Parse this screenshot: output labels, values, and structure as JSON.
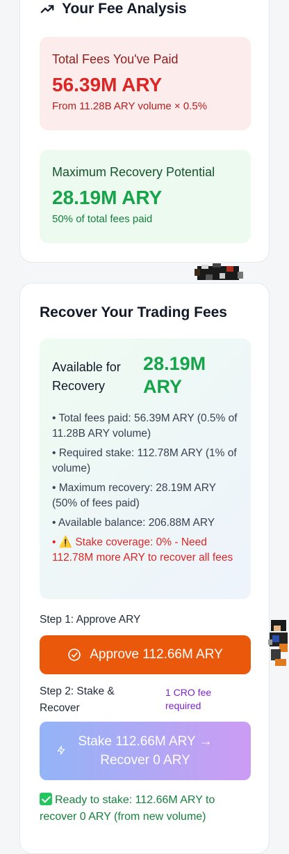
{
  "fee_analysis": {
    "title": "Your Fee Analysis",
    "total_fees": {
      "label": "Total Fees You've Paid",
      "value": "56.39M ARY",
      "detail": "From 11.28B ARY volume × 0.5%"
    },
    "max_recovery": {
      "label": "Maximum Recovery Potential",
      "value": "28.19M ARY",
      "detail": "50% of total fees paid"
    }
  },
  "recover": {
    "title": "Recover Your Trading Fees",
    "available_label": "Available for Recovery",
    "available_value": "28.19M ARY",
    "bullets": [
      "• Total fees paid: 56.39M ARY (0.5% of 11.28B ARY volume)",
      "• Required stake: 112.78M ARY (1% of volume)",
      "• Maximum recovery: 28.19M ARY (50% of fees paid)",
      "• Available balance: 206.88M ARY"
    ],
    "warning": "• ⚠️ Stake coverage: 0% - Need 112.78M more ARY to recover all fees",
    "step1_label": "Step 1: Approve ARY",
    "approve_button": "Approve 112.66M ARY",
    "step2_label": "Step 2: Stake & Recover",
    "fee_note": "1 CRO fee required",
    "stake_button": "Stake 112.66M ARY → Recover 0 ARY",
    "ready_text": "Ready to stake: 112.66M ARY to recover 0 ARY (from new volume)"
  },
  "colors": {
    "approve": "#ea580c",
    "success": "#16a34a",
    "danger": "#dc2626",
    "purple": "#7e22ce"
  }
}
